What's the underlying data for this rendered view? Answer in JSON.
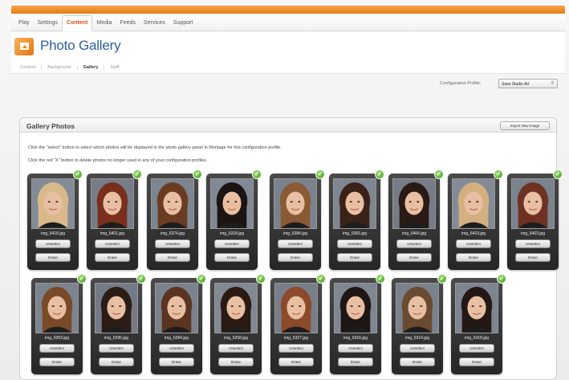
{
  "topnav": {
    "tabs": [
      "Play",
      "Settings",
      "Content",
      "Media",
      "Feeds",
      "Services",
      "Support"
    ],
    "active_index": 2
  },
  "header": {
    "title": "Photo Gallery",
    "icon": "photo-gallery-icon"
  },
  "subnav": {
    "items": [
      "Content",
      "Background",
      "Gallery",
      "Staff"
    ],
    "active_index": 2
  },
  "config": {
    "label": "Configuration Profile:",
    "value": "Save Studio Art"
  },
  "gallery": {
    "title": "Gallery Photos",
    "import_label": "Import New Image",
    "instructions": [
      "Click the \"select\" button to select which photos will be displayed in the photo gallery panel in Montage for this configuration profile.",
      "Click the red \"X\" button to delete photos no longer used in any of your configuration profiles."
    ],
    "select_label": "Unselect",
    "delete_label": "Erase",
    "photos": [
      {
        "filename": "img_6418.jpg",
        "selected": true,
        "hair": "#d9b98a",
        "bg": "#838b96"
      },
      {
        "filename": "img_6401.jpg",
        "selected": true,
        "hair": "#7a2e1c",
        "bg": "#767d88"
      },
      {
        "filename": "img_6374.jpg",
        "selected": true,
        "hair": "#6a3c22",
        "bg": "#7c8590"
      },
      {
        "filename": "img_6318.jpg",
        "selected": true,
        "hair": "#1c1412",
        "bg": "#818995"
      },
      {
        "filename": "img_6384.jpg",
        "selected": true,
        "hair": "#8a5a34",
        "bg": "#7a828d"
      },
      {
        "filename": "img_6365.jpg",
        "selected": true,
        "hair": "#3a2218",
        "bg": "#7e8692"
      },
      {
        "filename": "img_6464.jpg",
        "selected": true,
        "hair": "#2a1a14",
        "bg": "#757c87"
      },
      {
        "filename": "img_6419.jpg",
        "selected": true,
        "hair": "#d4b080",
        "bg": "#838b96"
      },
      {
        "filename": "img_6403.jpg",
        "selected": true,
        "hair": "#6e3222",
        "bg": "#7b838e"
      },
      {
        "filename": "img_6303.jpg",
        "selected": true,
        "hair": "#7a4a28",
        "bg": "#7c8490"
      },
      {
        "filename": "img_6295.jpg",
        "selected": true,
        "hair": "#2c1c16",
        "bg": "#747b86"
      },
      {
        "filename": "img_6284.jpg",
        "selected": true,
        "hair": "#5a3420",
        "bg": "#7a828d"
      },
      {
        "filename": "img_6258.jpg",
        "selected": true,
        "hair": "#2a1a12",
        "bg": "#818995"
      },
      {
        "filename": "img_6327.jpg",
        "selected": true,
        "hair": "#8c4a2a",
        "bg": "#787f8a"
      },
      {
        "filename": "img_6316.jpg",
        "selected": true,
        "hair": "#1e1614",
        "bg": "#7f8793"
      },
      {
        "filename": "img_6314.jpg",
        "selected": true,
        "hair": "#6a4a30",
        "bg": "#7a828d"
      },
      {
        "filename": "img_6318.jpg",
        "selected": true,
        "hair": "#241814",
        "bg": "#7d8591"
      }
    ]
  }
}
